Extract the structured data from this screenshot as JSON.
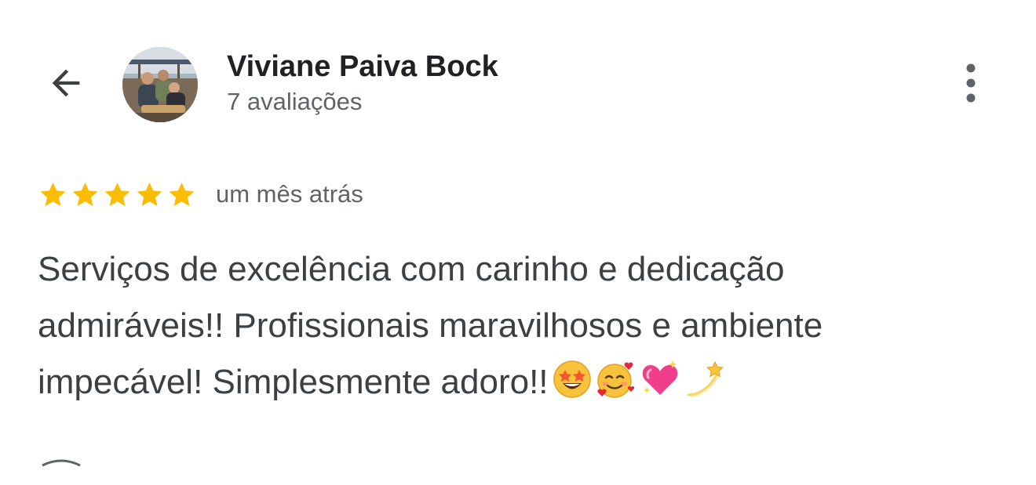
{
  "header": {
    "back_icon": "arrow-left-icon",
    "reviewer_name": "Viviane Paiva Bock",
    "review_count": "7 avaliações",
    "more_icon": "more-vertical-icon"
  },
  "review": {
    "rating": 5,
    "rating_max": 5,
    "star_color": "#fbbc04",
    "date": "um mês atrás",
    "text": "Serviços de excelência com carinho e dedicação admiráveis!! Profissionais maravilhosos e ambiente impecável! Simplesmente adoro!!",
    "emojis": [
      "star-struck-emoji",
      "smiling-face-with-hearts-emoji",
      "sparkling-heart-emoji",
      "dizzy-emoji"
    ]
  }
}
